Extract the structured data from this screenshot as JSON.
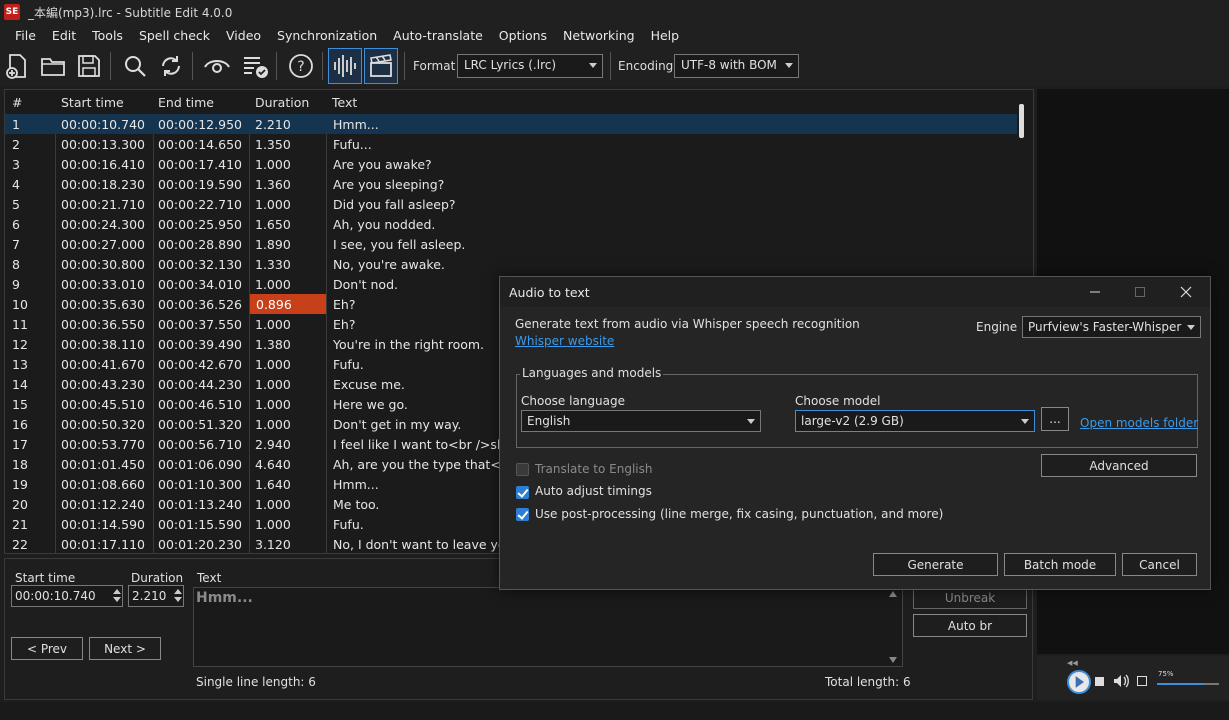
{
  "window": {
    "title": "_本編(mp3).lrc - Subtitle Edit 4.0.0",
    "icon_text": "SE"
  },
  "menu": [
    "File",
    "Edit",
    "Tools",
    "Spell check",
    "Video",
    "Synchronization",
    "Auto-translate",
    "Options",
    "Networking",
    "Help"
  ],
  "toolbar": {
    "format_label": "Format",
    "format_value": "LRC Lyrics (.lrc)",
    "encoding_label": "Encoding",
    "encoding_value": "UTF-8 with BOM"
  },
  "grid": {
    "headers": {
      "num": "#",
      "start": "Start time",
      "end": "End time",
      "duration": "Duration",
      "text": "Text"
    },
    "rows": [
      {
        "num": "1",
        "start": "00:00:10.740",
        "end": "00:00:12.950",
        "duration": "2.210",
        "text": "Hmm..."
      },
      {
        "num": "2",
        "start": "00:00:13.300",
        "end": "00:00:14.650",
        "duration": "1.350",
        "text": "Fufu..."
      },
      {
        "num": "3",
        "start": "00:00:16.410",
        "end": "00:00:17.410",
        "duration": "1.000",
        "text": "Are you awake?"
      },
      {
        "num": "4",
        "start": "00:00:18.230",
        "end": "00:00:19.590",
        "duration": "1.360",
        "text": "Are you sleeping?"
      },
      {
        "num": "5",
        "start": "00:00:21.710",
        "end": "00:00:22.710",
        "duration": "1.000",
        "text": "Did you fall asleep?"
      },
      {
        "num": "6",
        "start": "00:00:24.300",
        "end": "00:00:25.950",
        "duration": "1.650",
        "text": "Ah, you nodded."
      },
      {
        "num": "7",
        "start": "00:00:27.000",
        "end": "00:00:28.890",
        "duration": "1.890",
        "text": "I see, you fell asleep."
      },
      {
        "num": "8",
        "start": "00:00:30.800",
        "end": "00:00:32.130",
        "duration": "1.330",
        "text": "No, you're awake."
      },
      {
        "num": "9",
        "start": "00:00:33.010",
        "end": "00:00:34.010",
        "duration": "1.000",
        "text": "Don't nod."
      },
      {
        "num": "10",
        "start": "00:00:35.630",
        "end": "00:00:36.526",
        "duration": "0.896",
        "text": "Eh?"
      },
      {
        "num": "11",
        "start": "00:00:36.550",
        "end": "00:00:37.550",
        "duration": "1.000",
        "text": "Eh?"
      },
      {
        "num": "12",
        "start": "00:00:38.110",
        "end": "00:00:39.490",
        "duration": "1.380",
        "text": "You're in the right room."
      },
      {
        "num": "13",
        "start": "00:00:41.670",
        "end": "00:00:42.670",
        "duration": "1.000",
        "text": "Fufu."
      },
      {
        "num": "14",
        "start": "00:00:43.230",
        "end": "00:00:44.230",
        "duration": "1.000",
        "text": "Excuse me."
      },
      {
        "num": "15",
        "start": "00:00:45.510",
        "end": "00:00:46.510",
        "duration": "1.000",
        "text": "Here we go."
      },
      {
        "num": "16",
        "start": "00:00:50.320",
        "end": "00:00:51.320",
        "duration": "1.000",
        "text": "Don't get in my way."
      },
      {
        "num": "17",
        "start": "00:00:53.770",
        "end": "00:00:56.710",
        "duration": "2.940",
        "text": "I feel like I want to<br />slee"
      },
      {
        "num": "18",
        "start": "00:01:01.450",
        "end": "00:01:06.090",
        "duration": "4.640",
        "text": "Ah, are you the type that<br"
      },
      {
        "num": "19",
        "start": "00:01:08.660",
        "end": "00:01:10.300",
        "duration": "1.640",
        "text": "Hmm..."
      },
      {
        "num": "20",
        "start": "00:01:12.240",
        "end": "00:01:13.240",
        "duration": "1.000",
        "text": "Me too."
      },
      {
        "num": "21",
        "start": "00:01:14.590",
        "end": "00:01:15.590",
        "duration": "1.000",
        "text": "Fufu."
      },
      {
        "num": "22",
        "start": "00:01:17.110",
        "end": "00:01:20.230",
        "duration": "3.120",
        "text": "No, I don't want to leave you."
      }
    ]
  },
  "edit": {
    "start_label": "Start time",
    "start_value": "00:00:10.740",
    "duration_label": "Duration",
    "duration_value": "2.210",
    "text_label": "Text",
    "text_value": "Hmm...",
    "prev_label": "< Prev",
    "next_label": "Next >",
    "unbreak_label": "Unbreak",
    "autobr_label": "Auto br",
    "single_line": "Single line length: 6",
    "total_length": "Total length: 6"
  },
  "player": {
    "volume": "75%"
  },
  "dialog": {
    "title": "Audio to text",
    "description": "Generate text from audio via Whisper speech recognition",
    "website_link": "Whisper website",
    "engine_label": "Engine",
    "engine_value": "Purfview's Faster-Whisper",
    "group_title": "Languages and models",
    "language_label": "Choose language",
    "language_value": "English",
    "model_label": "Choose model",
    "model_value": "large-v2 (2.9 GB)",
    "browse_label": "...",
    "open_models_link": "Open models folder",
    "advanced_label": "Advanced",
    "translate_label": "Translate to English",
    "auto_adjust_label": "Auto adjust timings",
    "post_processing_label": "Use post-processing (line merge, fix casing, punctuation, and more)",
    "generate_label": "Generate",
    "batch_label": "Batch mode",
    "cancel_label": "Cancel"
  }
}
